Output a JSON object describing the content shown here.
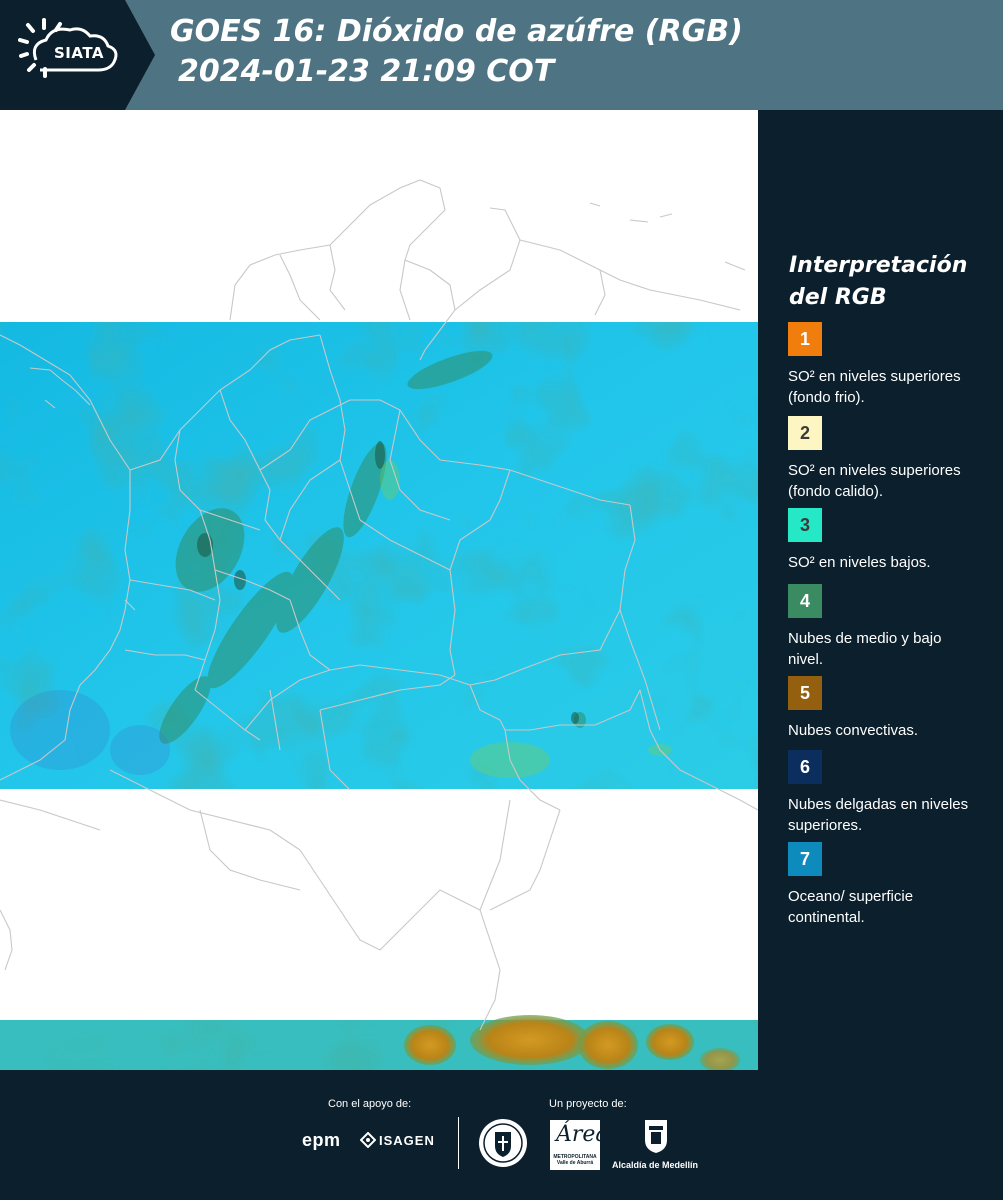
{
  "header": {
    "logo_text": "SIATA",
    "title_line1": "GOES 16: Dióxido de azúfre (RGB)",
    "title_line2": "2024-01-23 21:09 COT"
  },
  "legend": {
    "title_line1": "Interpretación",
    "title_line2": "del RGB",
    "items": [
      {
        "number": "1",
        "color": "#f07d0c",
        "label": "SO² en niveles superiores (fondo frio)."
      },
      {
        "number": "2",
        "color": "#fdf6c3",
        "label": "SO² en niveles superiores (fondo calido)."
      },
      {
        "number": "3",
        "color": "#25e8c6",
        "label": "SO² en niveles bajos."
      },
      {
        "number": "4",
        "color": "#3a8a62",
        "label": "Nubes de medio y bajo nivel."
      },
      {
        "number": "5",
        "color": "#946010",
        "label": "Nubes convectivas."
      },
      {
        "number": "6",
        "color": "#0c2e5e",
        "label": "Nubes delgadas en niveles superiores."
      },
      {
        "number": "7",
        "color": "#0e8bbd",
        "label": "Oceano/ superficie continental."
      }
    ]
  },
  "footer": {
    "support_label": "Con el apoyo de:",
    "project_label": "Un proyecto de:",
    "epm_logo": "epm",
    "isagen_logo": "ISAGEN",
    "area_logo_script": "Área",
    "area_logo_sub": "METROPOLITANA Valle de Aburrá",
    "alcaldia_label": "Alcaldía de Medellín"
  },
  "colors": {
    "header_bg": "#4e7483",
    "logo_bg": "#0c1f2c",
    "panel_bg": "#0c1f2c",
    "imagery_cyan": "#1ec3e6",
    "imagery_convective": "#c48a18",
    "borders": "#c8c8c8"
  }
}
